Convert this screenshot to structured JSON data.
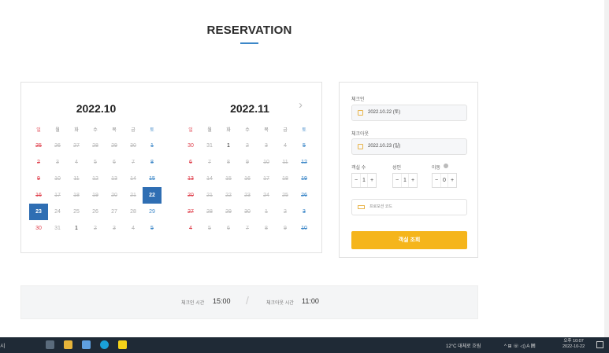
{
  "page": {
    "title": "RESERVATION"
  },
  "calendar": {
    "next_label": "›",
    "weekdays": [
      "일",
      "월",
      "화",
      "수",
      "목",
      "금",
      "토"
    ],
    "months": [
      {
        "label": "2022.10",
        "weeks": [
          [
            "25",
            "26",
            "27",
            "28",
            "29",
            "30",
            "1"
          ],
          [
            "2",
            "3",
            "4",
            "5",
            "6",
            "7",
            "8"
          ],
          [
            "9",
            "10",
            "11",
            "12",
            "13",
            "14",
            "15"
          ],
          [
            "16",
            "17",
            "18",
            "19",
            "20",
            "21",
            "22"
          ],
          [
            "23",
            "24",
            "25",
            "26",
            "27",
            "28",
            "29"
          ],
          [
            "30",
            "31",
            "1",
            "2",
            "3",
            "4",
            "5"
          ]
        ]
      },
      {
        "label": "2022.11",
        "weeks": [
          [
            "30",
            "31",
            "1",
            "2",
            "3",
            "4",
            "5"
          ],
          [
            "6",
            "7",
            "8",
            "9",
            "10",
            "11",
            "12"
          ],
          [
            "13",
            "14",
            "15",
            "16",
            "17",
            "18",
            "19"
          ],
          [
            "20",
            "21",
            "22",
            "23",
            "24",
            "25",
            "26"
          ],
          [
            "27",
            "28",
            "29",
            "30",
            "1",
            "2",
            "3"
          ],
          [
            "4",
            "5",
            "6",
            "7",
            "8",
            "9",
            "10"
          ]
        ]
      }
    ]
  },
  "booking": {
    "checkin_label": "체크인",
    "checkin_value": "2022.10.22 (토)",
    "checkout_label": "체크아웃",
    "checkout_value": "2022.10.23 (일)",
    "rooms_label": "객실 수",
    "adults_label": "성인",
    "children_label": "아동",
    "rooms": "1",
    "adults": "1",
    "children": "0",
    "minus": "−",
    "plus": "+",
    "promo_placeholder": "프로모션 코드",
    "search_button": "객실 조회"
  },
  "info": {
    "checkin_time_label": "체크인 시간",
    "checkin_time": "15:00",
    "checkout_time_label": "체크아웃 시간",
    "checkout_time": "11:00",
    "divider": "/"
  },
  "taskbar": {
    "search_hint": "시",
    "weather": "12°C 대체로 흐림",
    "tray": "^ ⊞ ☏ ◁) A 囲",
    "time": "오후 10:07",
    "date": "2022-10-22"
  }
}
